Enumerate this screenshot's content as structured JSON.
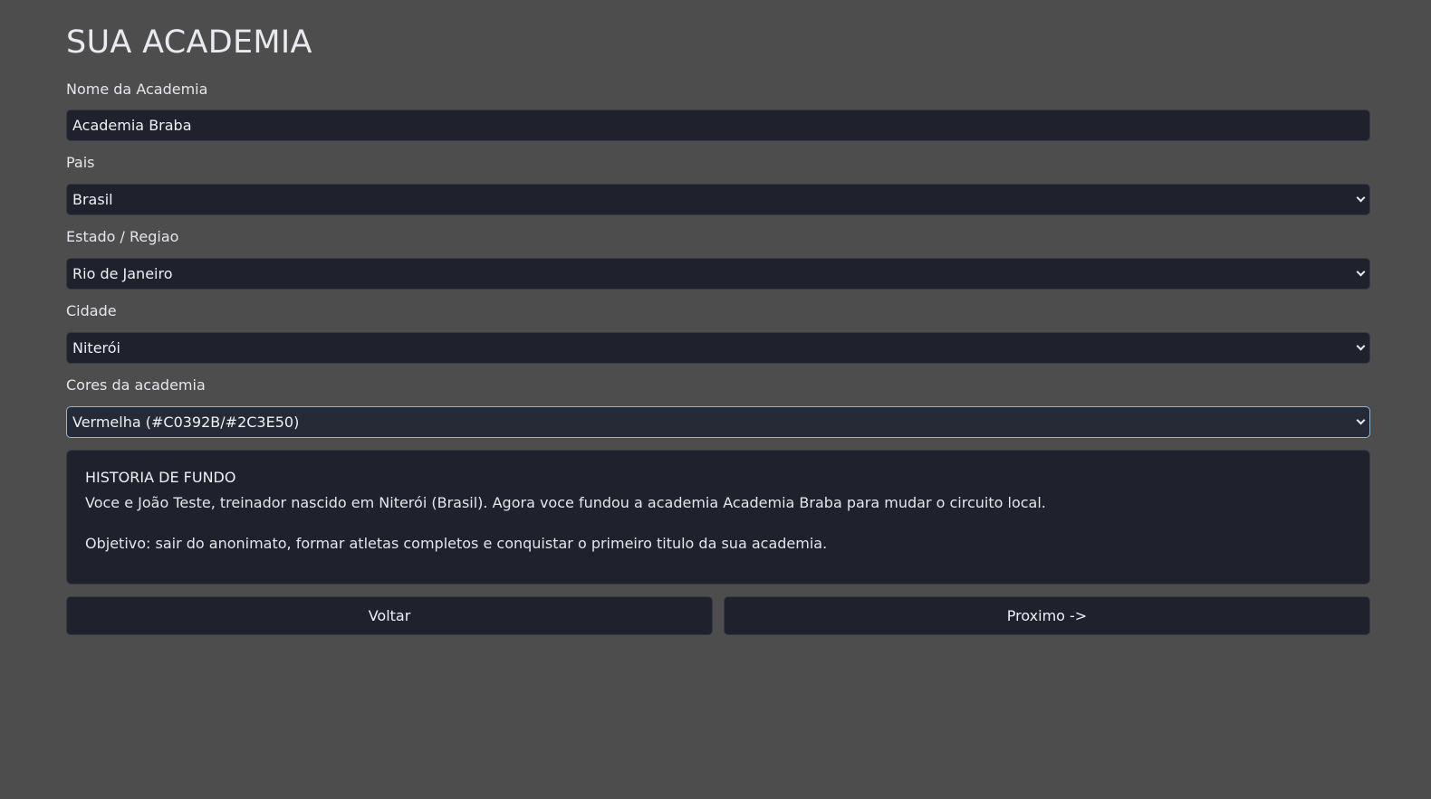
{
  "page": {
    "title": "SUA ACADEMIA"
  },
  "form": {
    "gym_name": {
      "label": "Nome da Academia",
      "value": "Academia Braba"
    },
    "country": {
      "label": "Pais",
      "value": "Brasil"
    },
    "state": {
      "label": "Estado / Regiao",
      "value": "Rio de Janeiro"
    },
    "city": {
      "label": "Cidade",
      "value": "Niterói"
    },
    "colors": {
      "label": "Cores da academia",
      "value": "Vermelha (#C0392B/#2C3E50)"
    }
  },
  "story": {
    "title": "HISTORIA DE FUNDO",
    "text": "Voce e João Teste, treinador nascido em Niterói (Brasil). Agora voce fundou a academia Academia Braba para mudar o circuito local.",
    "objective": "Objetivo: sair do anonimato, formar atletas completos e conquistar o primeiro titulo da sua academia."
  },
  "actions": {
    "back_label": "Voltar",
    "next_label": "Proximo ->"
  },
  "colors": {
    "background": "#4d4d4d",
    "field_background": "#1f222c",
    "focus_border": "#8fb8d6"
  }
}
